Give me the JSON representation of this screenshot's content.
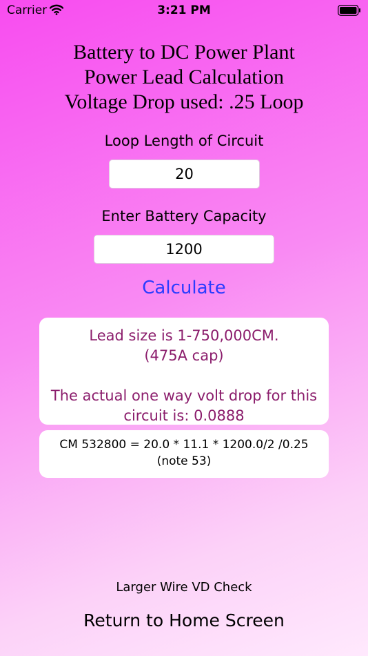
{
  "status_bar": {
    "carrier": "Carrier",
    "time": "3:21 PM",
    "icons": [
      "wifi-icon",
      "battery-icon"
    ]
  },
  "title": {
    "line1": "Battery to DC Power Plant",
    "line2": "Power Lead Calculation",
    "line3": "Voltage Drop used: .25 Loop"
  },
  "loop_length": {
    "label": "Loop Length of Circuit",
    "value": "20"
  },
  "battery_capacity": {
    "label": "Enter Battery Capacity",
    "value": "1200"
  },
  "calculate_label": "Calculate",
  "result": {
    "line1": "Lead size is 1-750,000CM.",
    "line2": "(475A cap)",
    "line3": "The actual one way volt drop for this",
    "line4": "circuit is: 0.0888"
  },
  "formula": {
    "line1": "CM 532800 = 20.0 * 11.1 * 1200.0/2 /0.25",
    "line2": "(note 53)"
  },
  "links": {
    "vd_check": "Larger Wire VD Check",
    "home": "Return to Home Screen"
  },
  "colors": {
    "accent": "#2b3cff",
    "result_text": "#8b1d6c",
    "background_top": "#f84cf0",
    "background_bottom": "#ffe9fd"
  }
}
